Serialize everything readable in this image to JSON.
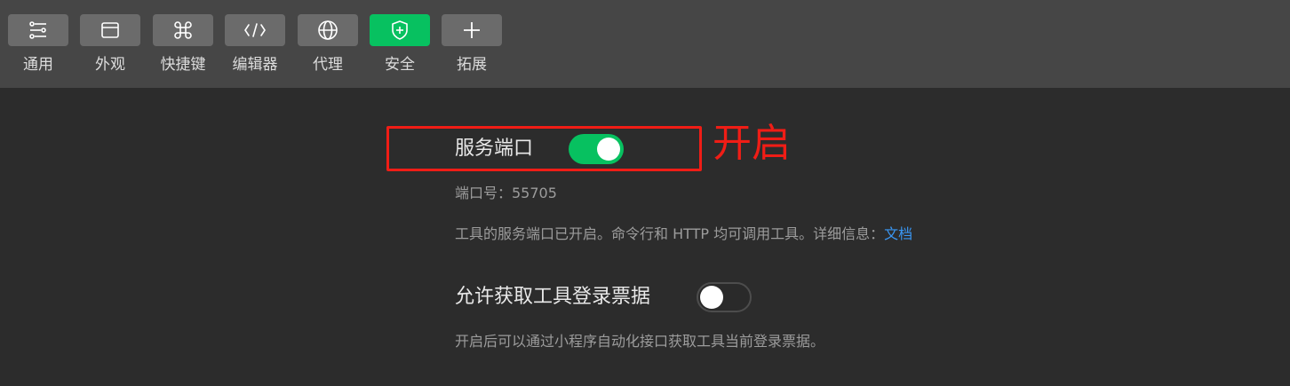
{
  "toolbar": {
    "tabs": [
      {
        "label": "通用",
        "icon": "sliders-icon"
      },
      {
        "label": "外观",
        "icon": "window-icon"
      },
      {
        "label": "快捷键",
        "icon": "command-key-icon"
      },
      {
        "label": "编辑器",
        "icon": "code-icon"
      },
      {
        "label": "代理",
        "icon": "globe-icon"
      },
      {
        "label": "安全",
        "icon": "shield-plus-icon",
        "active": true
      },
      {
        "label": "拓展",
        "icon": "plus-icon"
      }
    ],
    "active_color": "#07c160"
  },
  "service_port": {
    "label": "服务端口",
    "enabled": true,
    "port_text": "端口号：55705",
    "description": "工具的服务端口已开启。命令行和 HTTP 均可调用工具。详细信息：",
    "doc_link": "文档"
  },
  "login_ticket": {
    "label": "允许获取工具登录票据",
    "enabled": false,
    "description": "开启后可以通过小程序自动化接口获取工具当前登录票据。"
  },
  "annotation": {
    "text": "开启",
    "color": "#f01d16"
  }
}
